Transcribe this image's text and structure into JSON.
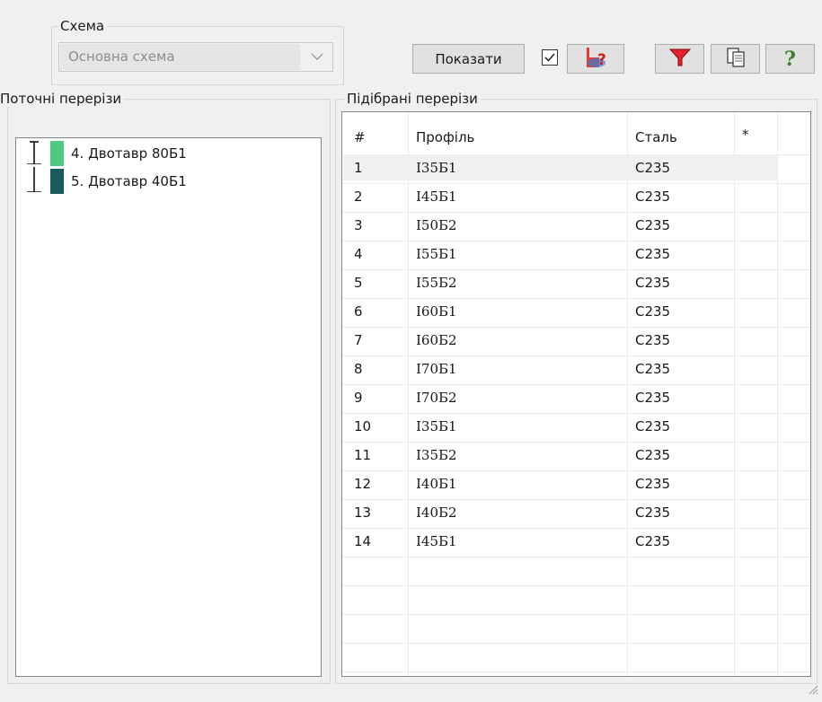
{
  "scheme": {
    "legend": "Схема",
    "selected": "Основна схема"
  },
  "toolbar": {
    "show_label": "Показати",
    "checkbox_checked": true,
    "icons": [
      "reset-selection-icon",
      "filter-icon",
      "copy-icon",
      "help-icon"
    ],
    "help_glyph": "?"
  },
  "current_sections": {
    "legend": "Поточні перерізи",
    "items": [
      {
        "label": "4. Двотавр 80Б1",
        "color": "#4fc97f"
      },
      {
        "label": "5. Двотавр 40Б1",
        "color": "#185c5c"
      }
    ]
  },
  "selected_sections": {
    "legend": "Підібрані перерізи",
    "columns": [
      "#",
      "Профіль",
      "Сталь",
      "*"
    ],
    "rows": [
      [
        "1",
        "I35Б1",
        "С235",
        ""
      ],
      [
        "2",
        "I45Б1",
        "С235",
        ""
      ],
      [
        "3",
        "I50Б2",
        "С235",
        ""
      ],
      [
        "4",
        "I55Б1",
        "С235",
        ""
      ],
      [
        "5",
        "I55Б2",
        "С235",
        ""
      ],
      [
        "6",
        "I60Б1",
        "С235",
        ""
      ],
      [
        "7",
        "I60Б2",
        "С235",
        ""
      ],
      [
        "8",
        "I70Б1",
        "С235",
        ""
      ],
      [
        "9",
        "I70Б2",
        "С235",
        ""
      ],
      [
        "10",
        "I35Б1",
        "С235",
        ""
      ],
      [
        "11",
        "I35Б2",
        "С235",
        ""
      ],
      [
        "12",
        "I40Б1",
        "С235",
        ""
      ],
      [
        "13",
        "I40Б2",
        "С235",
        ""
      ],
      [
        "14",
        "I45Б1",
        "С235",
        ""
      ]
    ],
    "highlighted_row": 0
  }
}
